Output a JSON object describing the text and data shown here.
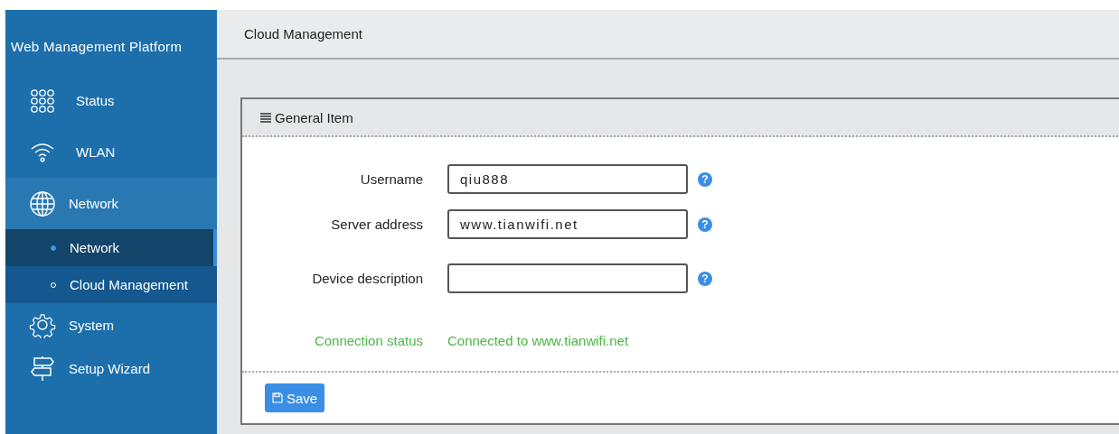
{
  "sidebar": {
    "title": "Web Management Platform",
    "items": [
      {
        "label": "Status",
        "expanded": false
      },
      {
        "label": "WLAN",
        "expanded": false
      },
      {
        "label": "Network",
        "expanded": true,
        "children": [
          {
            "label": "Network",
            "selected": true
          },
          {
            "label": "Cloud Management",
            "selected": false
          }
        ]
      },
      {
        "label": "System",
        "expanded": false
      },
      {
        "label": "Setup Wizard",
        "expanded": false
      }
    ]
  },
  "header": {
    "title": "Cloud Management"
  },
  "panel": {
    "title": "General Item",
    "fields": [
      {
        "label": "Username",
        "value": "qiu888",
        "help": "?"
      },
      {
        "label": "Server address",
        "value": "www.tianwifi.net",
        "help": "?"
      },
      {
        "label": "Device description",
        "help": "?"
      }
    ],
    "status": {
      "label": "Connection status",
      "value": "Connected to www.tianwifi.net"
    },
    "save_button": "Save"
  }
}
